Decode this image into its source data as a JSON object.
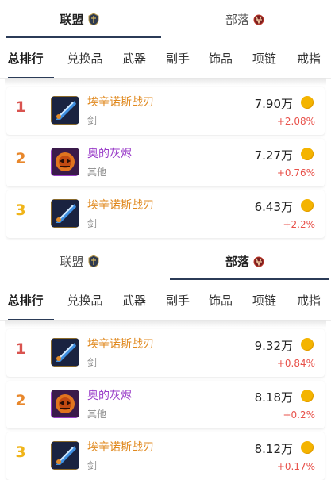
{
  "sections": [
    {
      "factions": [
        {
          "label": "联盟",
          "icon": "alliance-emblem-icon",
          "active": true
        },
        {
          "label": "部落",
          "icon": "horde-emblem-icon",
          "active": false
        }
      ],
      "categories": [
        "总排行",
        "兑换品",
        "武器",
        "副手",
        "饰品",
        "项链",
        "戒指"
      ],
      "active_category": "总排行",
      "items": [
        {
          "rank": "1",
          "name": "埃辛诺斯战刃",
          "type": "剑",
          "price": "7.90万",
          "change": "+2.08%",
          "icon": "warglaive-icon"
        },
        {
          "rank": "2",
          "name": "奥的灰烬",
          "type": "其他",
          "price": "7.27万",
          "change": "+0.76%",
          "icon": "ashes-icon"
        },
        {
          "rank": "3",
          "name": "埃辛诺斯战刃",
          "type": "剑",
          "price": "6.43万",
          "change": "+2.2%",
          "icon": "warglaive-icon"
        }
      ]
    },
    {
      "factions": [
        {
          "label": "联盟",
          "icon": "alliance-emblem-icon",
          "active": false
        },
        {
          "label": "部落",
          "icon": "horde-emblem-icon",
          "active": true
        }
      ],
      "categories": [
        "总排行",
        "兑换品",
        "武器",
        "副手",
        "饰品",
        "项链",
        "戒指"
      ],
      "active_category": "总排行",
      "items": [
        {
          "rank": "1",
          "name": "埃辛诺斯战刃",
          "type": "剑",
          "price": "9.32万",
          "change": "+0.84%",
          "icon": "warglaive-icon"
        },
        {
          "rank": "2",
          "name": "奥的灰烬",
          "type": "其他",
          "price": "8.18万",
          "change": "+0.2%",
          "icon": "ashes-icon"
        },
        {
          "rank": "3",
          "name": "埃辛诺斯战刃",
          "type": "剑",
          "price": "8.12万",
          "change": "+0.17%",
          "icon": "warglaive-icon"
        }
      ]
    }
  ],
  "colors": {
    "accent": "#2b3b57",
    "legendary": "#e0891f",
    "epic": "#9b3fc9",
    "rise": "#e8514a",
    "gold_coin": "#f4b400"
  }
}
